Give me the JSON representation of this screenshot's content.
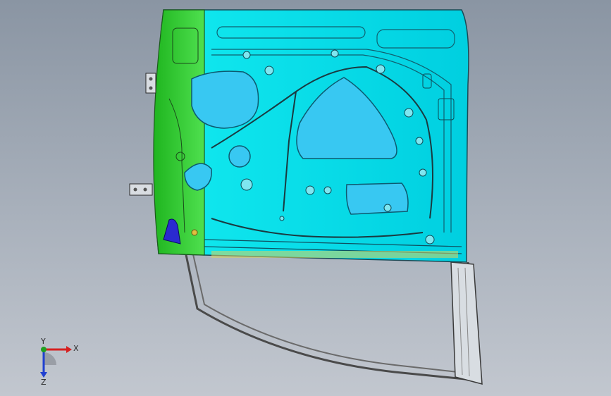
{
  "viewport": {
    "background_top": "#8a95a3",
    "background_bottom": "#c2c7cf"
  },
  "model": {
    "panel_color": "#00e5ee",
    "hole_color": "#33ccf5",
    "hinge_side_color": "#2fd52f",
    "frame_color": "#5a5a5a",
    "highlight_part_color": "#2a2ad0"
  },
  "triad": {
    "x_label": "X",
    "y_label": "Y",
    "z_label": "Z",
    "x_color": "#d62020",
    "y_color": "#20a020",
    "z_color": "#2040d0"
  }
}
